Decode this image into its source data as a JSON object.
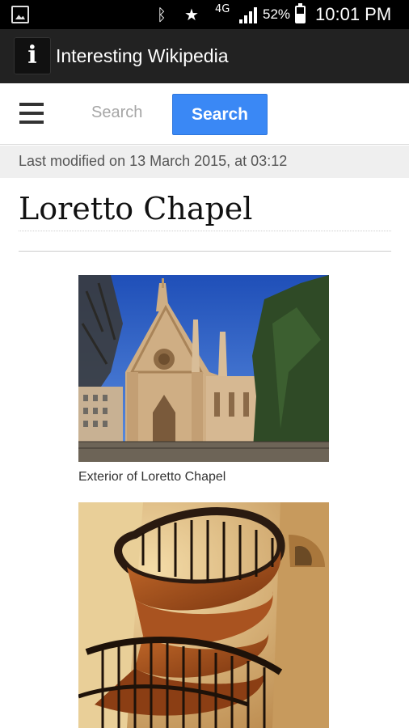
{
  "status_bar": {
    "battery": "52%",
    "time": "10:01 PM",
    "data_indicator": "4G"
  },
  "app_bar": {
    "logo_letter": "i",
    "title": "Interesting Wikipedia"
  },
  "search": {
    "placeholder": "Search",
    "button_label": "Search"
  },
  "article": {
    "last_modified": "Last modified on 13 March 2015, at 03:12",
    "title": "Loretto Chapel",
    "figures": [
      {
        "caption": "Exterior of Loretto Chapel"
      },
      {
        "caption": ""
      }
    ]
  },
  "icons": {
    "status_left": "image-icon",
    "bluetooth": "bluetooth-icon",
    "star": "star-icon",
    "signal": "signal-icon",
    "battery": "battery-icon",
    "menu": "hamburger-menu-icon"
  },
  "colors": {
    "app_bar": "#222222",
    "search_button": "#3a88f5",
    "meta_strip": "#efefef"
  }
}
